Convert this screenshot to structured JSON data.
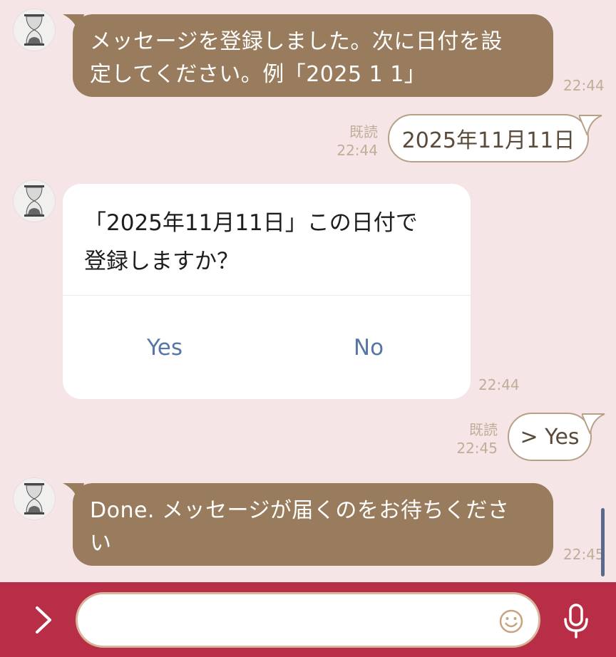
{
  "messages": {
    "bot1": {
      "text": "メッセージを登録しました。次に日付を設定してください。例「2025 1 1」",
      "line1": "メッセージを登録しました。次に日付を設",
      "line2": "定してください。例「2025 1 1」",
      "time": "22:44"
    },
    "user1": {
      "text": "2025年11月11日",
      "read": "既読",
      "time": "22:44"
    },
    "confirm": {
      "line1": "「2025年11月11日」この日付で",
      "line2": "登録しますか？",
      "yes_label": "Yes",
      "no_label": "No",
      "time": "22:44"
    },
    "user2": {
      "text": "> Yes",
      "read": "既読",
      "time": "22:45"
    },
    "bot2": {
      "line1": "Done. メッセージが届くのをお待ちくださ",
      "line2": "い",
      "time": "22:45"
    }
  },
  "input": {
    "placeholder": "",
    "value": ""
  },
  "icons": {
    "menu": "chevron-right-icon",
    "emoji": "smiley-icon",
    "mic": "microphone-icon",
    "avatar": "hourglass-icon"
  },
  "colors": {
    "background": "#f5e5e7",
    "bot_bubble": "#987c5d",
    "user_bubble_border": "#b6a088",
    "bottom_bar": "#b72e46",
    "link": "#5876a5"
  }
}
